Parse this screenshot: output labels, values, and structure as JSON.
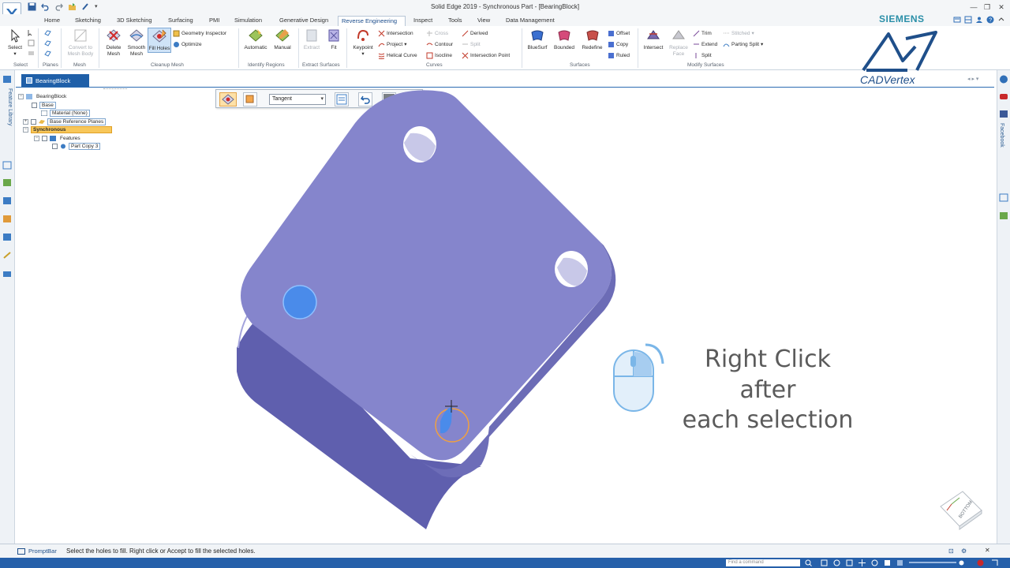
{
  "app": {
    "window_title": "Solid Edge 2019 - Synchronous Part - [BearingBlock]",
    "brand": "SIEMENS",
    "watermark": "CADVertex"
  },
  "tabs": [
    "Home",
    "Sketching",
    "3D Sketching",
    "Surfacing",
    "PMI",
    "Simulation",
    "Generative Design",
    "Reverse Engineering",
    "Inspect",
    "Tools",
    "View",
    "Data Management"
  ],
  "active_tab": "Reverse Engineering",
  "ribbon": {
    "select": {
      "label": "Select",
      "group": "Select"
    },
    "planes": {
      "label": "Planes",
      "group": "Planes"
    },
    "mesh": {
      "convert": "Convert to Mesh Body",
      "group": "Mesh"
    },
    "cleanup": {
      "delete": "Delete Mesh",
      "smooth": "Smooth Mesh",
      "fill": "Fill Holes",
      "geometry_inspector": "Geometry Inspector",
      "optimize": "Optimize",
      "group": "Cleanup Mesh"
    },
    "regions": {
      "automatic": "Automatic",
      "manual": "Manual",
      "group": "Identify Regions"
    },
    "extract": {
      "extract": "Extract",
      "fit": "Fit",
      "group": "Extract Surfaces"
    },
    "curves": {
      "keypoint": "Keypoint",
      "intersection": "Intersection",
      "project": "Project",
      "helical": "Helical Curve",
      "cross": "Cross",
      "contour": "Contour",
      "isocline": "Isocline",
      "derived": "Derived",
      "split": "Split",
      "intersection_point": "Intersection Point",
      "group": "Curves"
    },
    "surfaces": {
      "bluesurf": "BlueSurf",
      "bounded": "Bounded",
      "redefine": "Redefine",
      "offset": "Offset",
      "copy": "Copy",
      "ruled": "Ruled",
      "group": "Surfaces"
    },
    "modify": {
      "intersect": "Intersect",
      "replace_face": "Replace Face",
      "trim": "Trim",
      "extend": "Extend",
      "split": "Split",
      "stitched": "Stitched",
      "parting_split": "Parting Split",
      "group": "Modify Surfaces"
    }
  },
  "left_panel": {
    "feature_library": "Feature Library"
  },
  "document_tab": {
    "name": "BearingBlock",
    "close": "✕"
  },
  "tree": {
    "root": "BearingBlock",
    "base": "Base",
    "material": "Material (None)",
    "base_ref_planes": "Base Reference Planes",
    "synchronous": "Synchronous",
    "features": "Features",
    "part_copy": "Part Copy 3"
  },
  "command_bar": {
    "mode": "Tangent"
  },
  "overlay": {
    "hint_line1": "Right Click",
    "hint_line2": "after",
    "hint_line3": "each selection"
  },
  "view_cube": {
    "face": "BOTTOM"
  },
  "right_panel": {
    "facebook": "Facebook"
  },
  "prompt": {
    "label": "PromptBar",
    "message": "Select the holes to fill. Right click or Accept to fill the selected holes."
  },
  "status": {
    "find_placeholder": "Find a command"
  },
  "colors": {
    "part": "#8585cc",
    "part_dark": "#5f5fae",
    "accent": "#1f5fa8",
    "hole_selected": "#4a8bea",
    "highlight": "#f8c75a"
  }
}
